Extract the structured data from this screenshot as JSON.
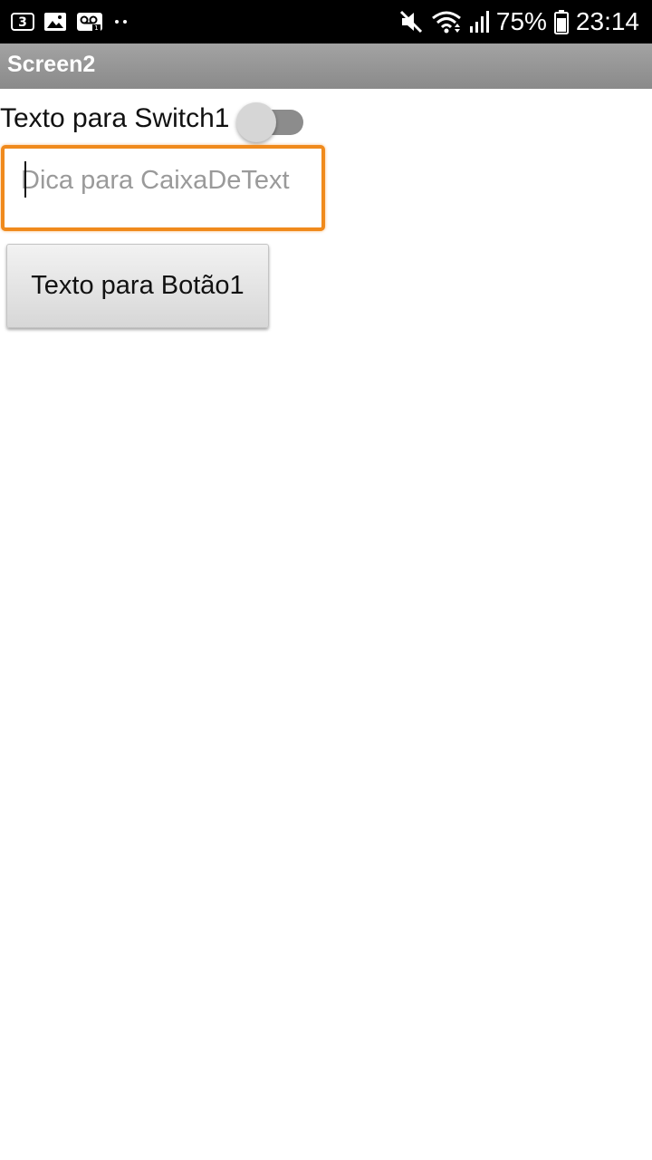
{
  "status_bar": {
    "left_icons": [
      "carrier-3-icon",
      "image-icon",
      "voicemail-icon",
      "more-dots-icon"
    ],
    "right_icons": [
      "mute-icon",
      "wifi-icon",
      "signal-icon",
      "battery-icon"
    ],
    "battery": "75%",
    "time": "23:14"
  },
  "title_bar": {
    "title": "Screen2"
  },
  "form": {
    "switch_label": "Texto para Switch1",
    "switch_on": false,
    "textbox_placeholder": "Dica para CaixaDeText",
    "textbox_value": "",
    "button_label": "Texto para Botão1"
  },
  "colors": {
    "status_bar_bg": "#000000",
    "title_bar_bg": "#999999",
    "textbox_focus_border": "#f08a1c",
    "switch_track": "#8c8c8c"
  }
}
